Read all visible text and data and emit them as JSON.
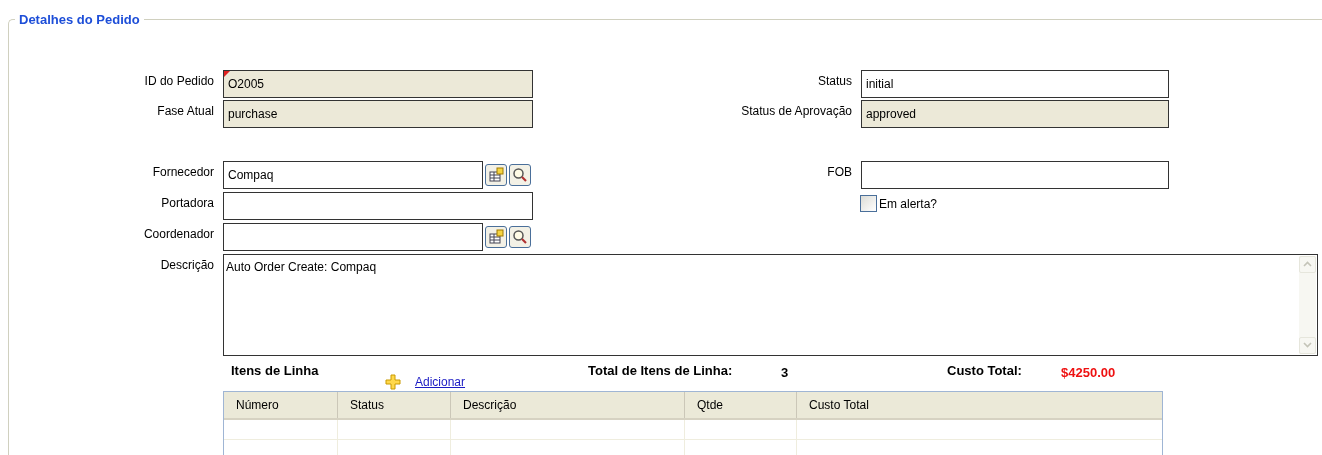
{
  "section": {
    "title": "Detalhes do Pedido"
  },
  "field_groups": [
    {
      "left": [
        {
          "kind": "readonly",
          "label": "ID do Pedido",
          "value": "O2005",
          "required": true
        },
        {
          "kind": "readonly",
          "label": "Fase Atual",
          "value": "purchase",
          "required": false
        }
      ],
      "right": [
        {
          "kind": "text",
          "label": "Status",
          "value": "initial",
          "required": false
        },
        {
          "kind": "readonly",
          "label": "Status de Aprovação",
          "value": "approved",
          "required": false
        }
      ]
    },
    {
      "left": [
        {
          "kind": "lookup",
          "label": "Fornecedor",
          "value": "Compaq",
          "required": false
        },
        {
          "kind": "text",
          "label": "Portadora",
          "required": false
        },
        {
          "kind": "lookup",
          "label": "Coordenador",
          "required": false
        }
      ],
      "right": [
        {
          "kind": "text",
          "label": "FOB",
          "required": false
        },
        {
          "kind": "checkbox",
          "label": "Em alerta?",
          "checked": false
        }
      ]
    }
  ],
  "description": {
    "label": "Descrição",
    "value": "Auto Order Create: Compaq"
  },
  "line_items": {
    "title": "Itens de Linha",
    "add_link": "Adicionar",
    "total_label": "Total de Itens de Linha:",
    "total_count": "3",
    "cost_label": "Custo Total:",
    "cost_value": "$4250.00",
    "columns": [
      "Número",
      "Status",
      "Descrição",
      "Qtde",
      "Custo Total"
    ]
  }
}
